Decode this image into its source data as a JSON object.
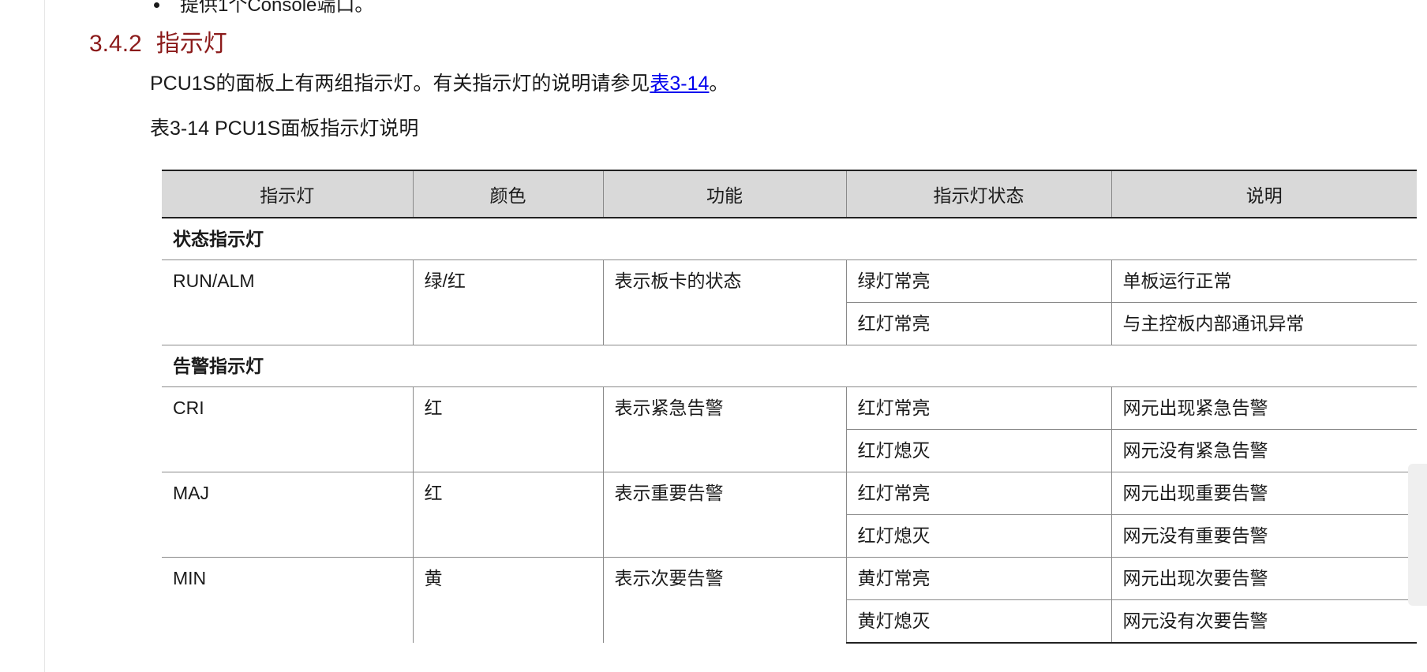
{
  "top_bullet": "提供1个Console端口。",
  "section": {
    "number": "3.4.2",
    "title": "指示灯"
  },
  "intro": {
    "text": "PCU1S的面板上有两组指示灯。有关指示灯的说明请参见",
    "link": "表3-14",
    "suffix": "。"
  },
  "caption": "表3-14 PCU1S面板指示灯说明",
  "table": {
    "headers": [
      "指示灯",
      "颜色",
      "功能",
      "指示灯状态",
      "说明"
    ],
    "group_status": "状态指示灯",
    "group_alarm": "告警指示灯",
    "rows": [
      {
        "name": "RUN/ALM",
        "color": "绿/红",
        "function": "表示板卡的状态",
        "states": [
          {
            "state": "绿灯常亮",
            "desc": "单板运行正常"
          },
          {
            "state": "红灯常亮",
            "desc": "与主控板内部通讯异常"
          }
        ]
      },
      {
        "name": "CRI",
        "color": "红",
        "function": "表示紧急告警",
        "states": [
          {
            "state": "红灯常亮",
            "desc": "网元出现紧急告警"
          },
          {
            "state": "红灯熄灭",
            "desc": "网元没有紧急告警"
          }
        ]
      },
      {
        "name": "MAJ",
        "color": "红",
        "function": "表示重要告警",
        "states": [
          {
            "state": "红灯常亮",
            "desc": "网元出现重要告警"
          },
          {
            "state": "红灯熄灭",
            "desc": "网元没有重要告警"
          }
        ]
      },
      {
        "name": "MIN",
        "color": "黄",
        "function": "表示次要告警",
        "states": [
          {
            "state": "黄灯常亮",
            "desc": "网元出现次要告警"
          },
          {
            "state": "黄灯熄灭",
            "desc": "网元没有次要告警"
          }
        ]
      }
    ]
  }
}
